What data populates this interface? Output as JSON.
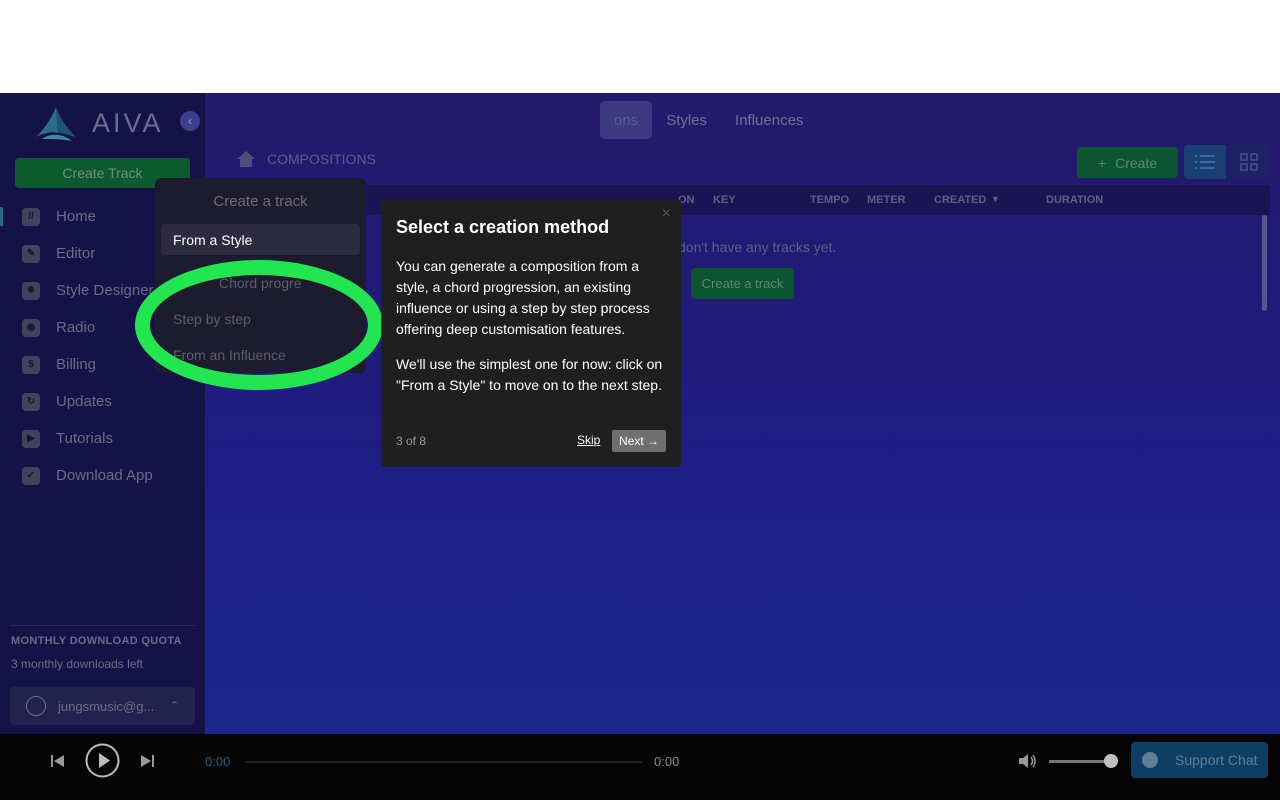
{
  "brand": {
    "name": "AIVA"
  },
  "sidebar": {
    "create_track_label": "Create Track",
    "items": [
      {
        "label": "Home",
        "icon": "home-icon",
        "active": true
      },
      {
        "label": "Editor",
        "icon": "pencil-icon"
      },
      {
        "label": "Style Designer",
        "icon": "palette-icon"
      },
      {
        "label": "Radio",
        "icon": "radio-icon"
      },
      {
        "label": "Billing",
        "icon": "dollar-icon"
      },
      {
        "label": "Updates",
        "icon": "refresh-icon"
      },
      {
        "label": "Tutorials",
        "icon": "play-icon"
      },
      {
        "label": "Download App",
        "icon": "download-icon"
      }
    ],
    "quota_title": "MONTHLY DOWNLOAD QUOTA",
    "quota_text": "3 monthly downloads left",
    "user_label": "jungsmusic@g..."
  },
  "tabs": [
    {
      "label": "ons",
      "active": true
    },
    {
      "label": "Styles"
    },
    {
      "label": "Influences"
    }
  ],
  "breadcrumb": {
    "label": "COMPOSITIONS"
  },
  "toolbar": {
    "create_label": "Create"
  },
  "table": {
    "columns": [
      "ON",
      "KEY",
      "TEMPO",
      "METER",
      "CREATED",
      "DURATION"
    ],
    "empty_text": "don't have any tracks yet.",
    "empty_button": "Create a track"
  },
  "dropdown": {
    "title": "Create a track",
    "options": [
      "From a Style",
      "Chord progre",
      "Step by step",
      "From an Influence"
    ]
  },
  "popover": {
    "title": "Select a creation method",
    "paragraph1": "You can generate a composition from a style, a chord progression, an existing influence or using a step by step process offering deep customisation features.",
    "paragraph2": "We'll use the simplest one for now: click on \"From a Style\" to move on to the next step.",
    "progress": "3 of 8",
    "skip_label": "Skip",
    "next_label": "Next →",
    "close_label": "×"
  },
  "player": {
    "time_current": "0:00",
    "time_total": "0:00",
    "support_label": "Support Chat"
  },
  "colors": {
    "highlight": "#22e650",
    "accent_green": "#0b5631",
    "background_gradient_top": "#24196a"
  }
}
